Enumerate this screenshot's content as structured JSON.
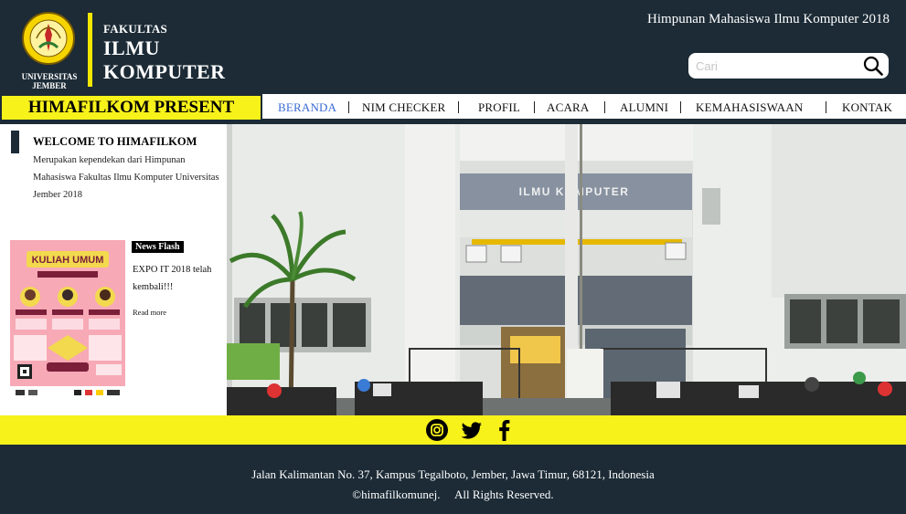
{
  "header": {
    "logo_text": [
      "UNIVERSITAS",
      "JEMBER"
    ],
    "faculty_small": "FAKULTAS",
    "faculty_line1": "ILMU",
    "faculty_line2": "KOMPUTER",
    "org_title": "Himpunan Mahasiswa Ilmu Komputer 2018",
    "search_placeholder": "Cari"
  },
  "nav": {
    "present": "HIMAFILKOM PRESENT",
    "items": [
      "BERANDA",
      "NIM CHECKER",
      "PROFIL",
      "ACARA",
      "ALUMNI",
      "KEMAHASISWAAN",
      "KONTAK"
    ],
    "active": "BERANDA"
  },
  "sidebar": {
    "welcome_title": "WELCOME TO HIMAFILKOM",
    "welcome_desc": "Merupakan kependekan dari Himpunan Mahasiswa Fakultas Ilmu Komputer Universitas Jember 2018",
    "poster_title": "KULIAH UMUM",
    "news_badge": "News Flash",
    "news_text": "EXPO IT 2018 telah kembali!!!",
    "news_more": "Read more"
  },
  "hero": {
    "building_sign": "ILMU KOMPUTER"
  },
  "social": [
    "instagram-icon",
    "twitter-icon",
    "facebook-icon"
  ],
  "footer": {
    "address": "Jalan Kalimantan No. 37, Kampus Tegalboto, Jember, Jawa Timur, 68121, Indonesia",
    "copyright": "©himafilkomunej.     All Rights Reserved."
  },
  "colors": {
    "dark": "#1c2b36",
    "yellow": "#f8f21b",
    "active_link": "#3a6ad6"
  }
}
